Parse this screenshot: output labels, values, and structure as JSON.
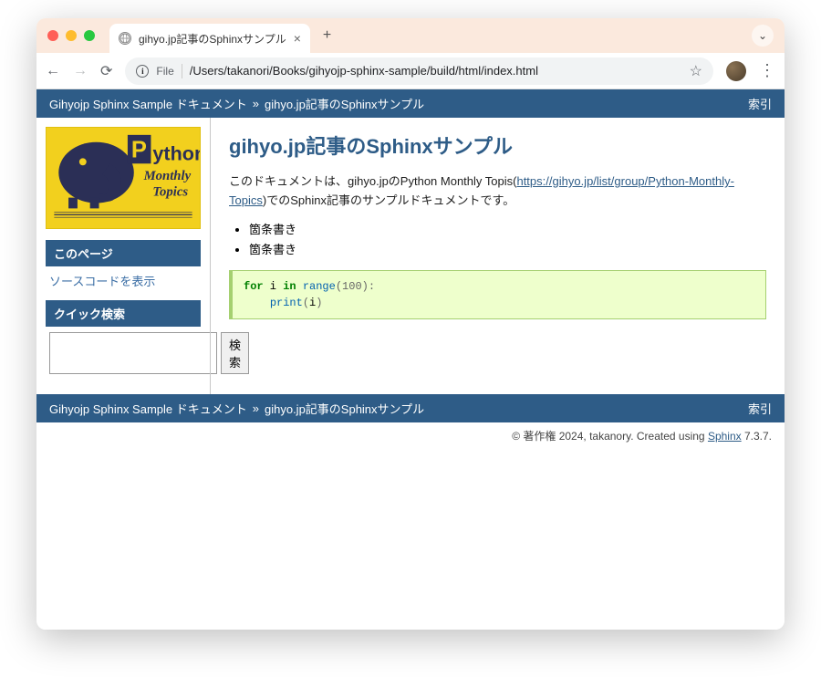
{
  "browser": {
    "tab_title": "gihyo.jp記事のSphinxサンプル",
    "url_scheme": "File",
    "url_path": "/Users/takanori/Books/gihyojp-sphinx-sample/build/html/index.html"
  },
  "related": {
    "home_label": "Gihyojp Sphinx Sample ドキュメント",
    "separator": "»",
    "current_label": "gihyo.jp記事のSphinxサンプル",
    "index_label": "索引"
  },
  "logo": {
    "line1": "ython",
    "line2": "Monthly",
    "line3": "Topics"
  },
  "sidebar": {
    "thispage_title": "このページ",
    "show_source": "ソースコードを表示",
    "quicksearch_title": "クイック検索",
    "search_button": "検索"
  },
  "main": {
    "heading": "gihyo.jp記事のSphinxサンプル",
    "intro_pre": "このドキュメントは、gihyo.jpのPython Monthly Topis(",
    "intro_link": "https://gihyo.jp/list/group/Python-Monthly-Topics",
    "intro_post": ")でのSphinx記事のサンプルドキュメントです。",
    "bullets": [
      "箇条書き",
      "箇条書き"
    ],
    "code": {
      "kw_for": "for",
      "var_i": " i ",
      "kw_in": "in",
      "fn_range": " range",
      "lpar": "(",
      "num": "100",
      "rpar_colon": "):",
      "indent": "    ",
      "fn_print": "print",
      "lpar2": "(",
      "arg": "i",
      "rpar2": ")"
    }
  },
  "footer": {
    "copyright": "© 著作権 2024, takanory. Created using ",
    "sphinx_label": "Sphinx",
    "version_suffix": " 7.3.7."
  }
}
